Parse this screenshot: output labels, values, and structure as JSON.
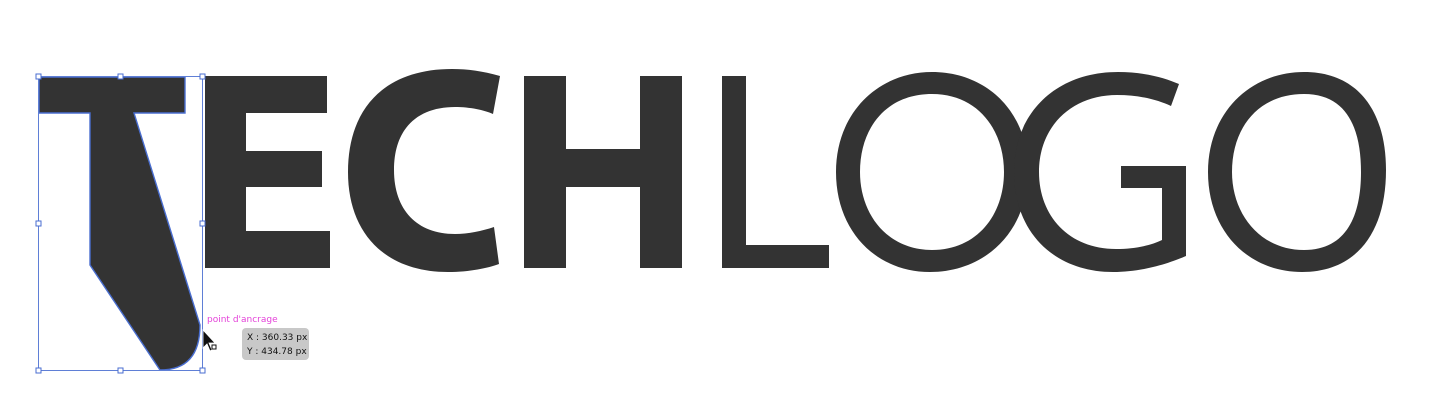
{
  "artwork": {
    "logo_text": "TECHLOGO",
    "bold_part": "TECH",
    "light_part": "LOGO",
    "fill_color": "#333333"
  },
  "selection": {
    "color": "#4a6ed0",
    "selected_glyph": "T",
    "handle_count": 8
  },
  "smart_guide": {
    "anchor_label": "point d'ancrage",
    "label_color": "#e442d9"
  },
  "coordinate_readout": {
    "x_text": "X : 360.33 px",
    "y_text": "Y : 434.78 px",
    "background": "#c8c8c8"
  },
  "cursor": {
    "icon": "direct-selection-arrow-icon"
  }
}
